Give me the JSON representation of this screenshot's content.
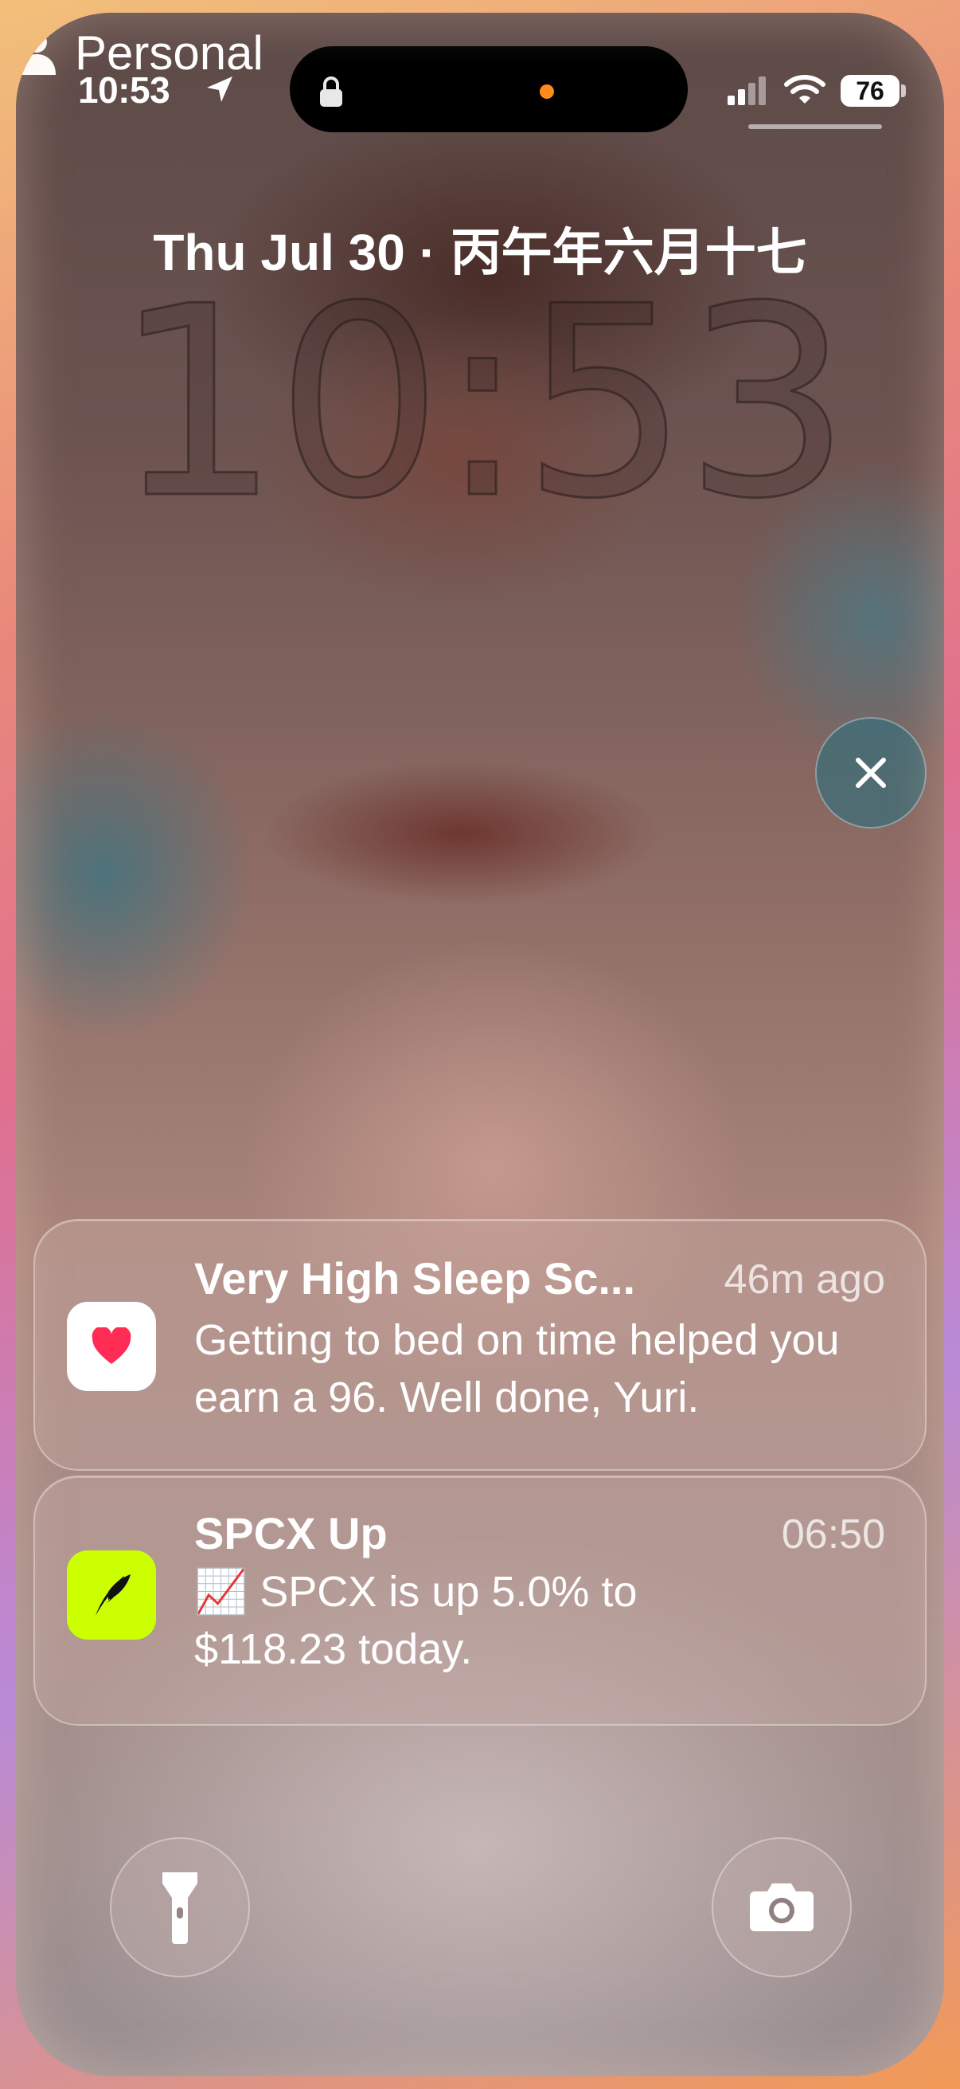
{
  "status_bar": {
    "time": "10:53",
    "battery": "76",
    "icons": [
      "location-arrow-icon",
      "lock-icon",
      "signal-icon",
      "wifi-icon",
      "battery-icon"
    ]
  },
  "lock_screen": {
    "date": "Thu Jul 30 · 丙午年六月十七",
    "clock": "10:53"
  },
  "notifications": [
    {
      "app": "Health",
      "icon": "heart-icon",
      "title": "Very High Sleep Sc...",
      "time": "46m ago",
      "body": "Getting to bed on time helped you earn a 96. Well done, Yuri."
    },
    {
      "app": "Robinhood",
      "icon": "feather-icon",
      "title": "SPCX Up",
      "time": "06:50",
      "body": "📈 SPCX is up 5.0% to $118.23 today."
    }
  ],
  "bottom": {
    "focus_label": "Personal",
    "flashlight_icon": "flashlight-icon",
    "camera_icon": "camera-icon"
  },
  "colors": {
    "health_icon_bg": "#ffffff",
    "heart": "#ff2d55",
    "robinhood_bg": "#ccff00"
  }
}
